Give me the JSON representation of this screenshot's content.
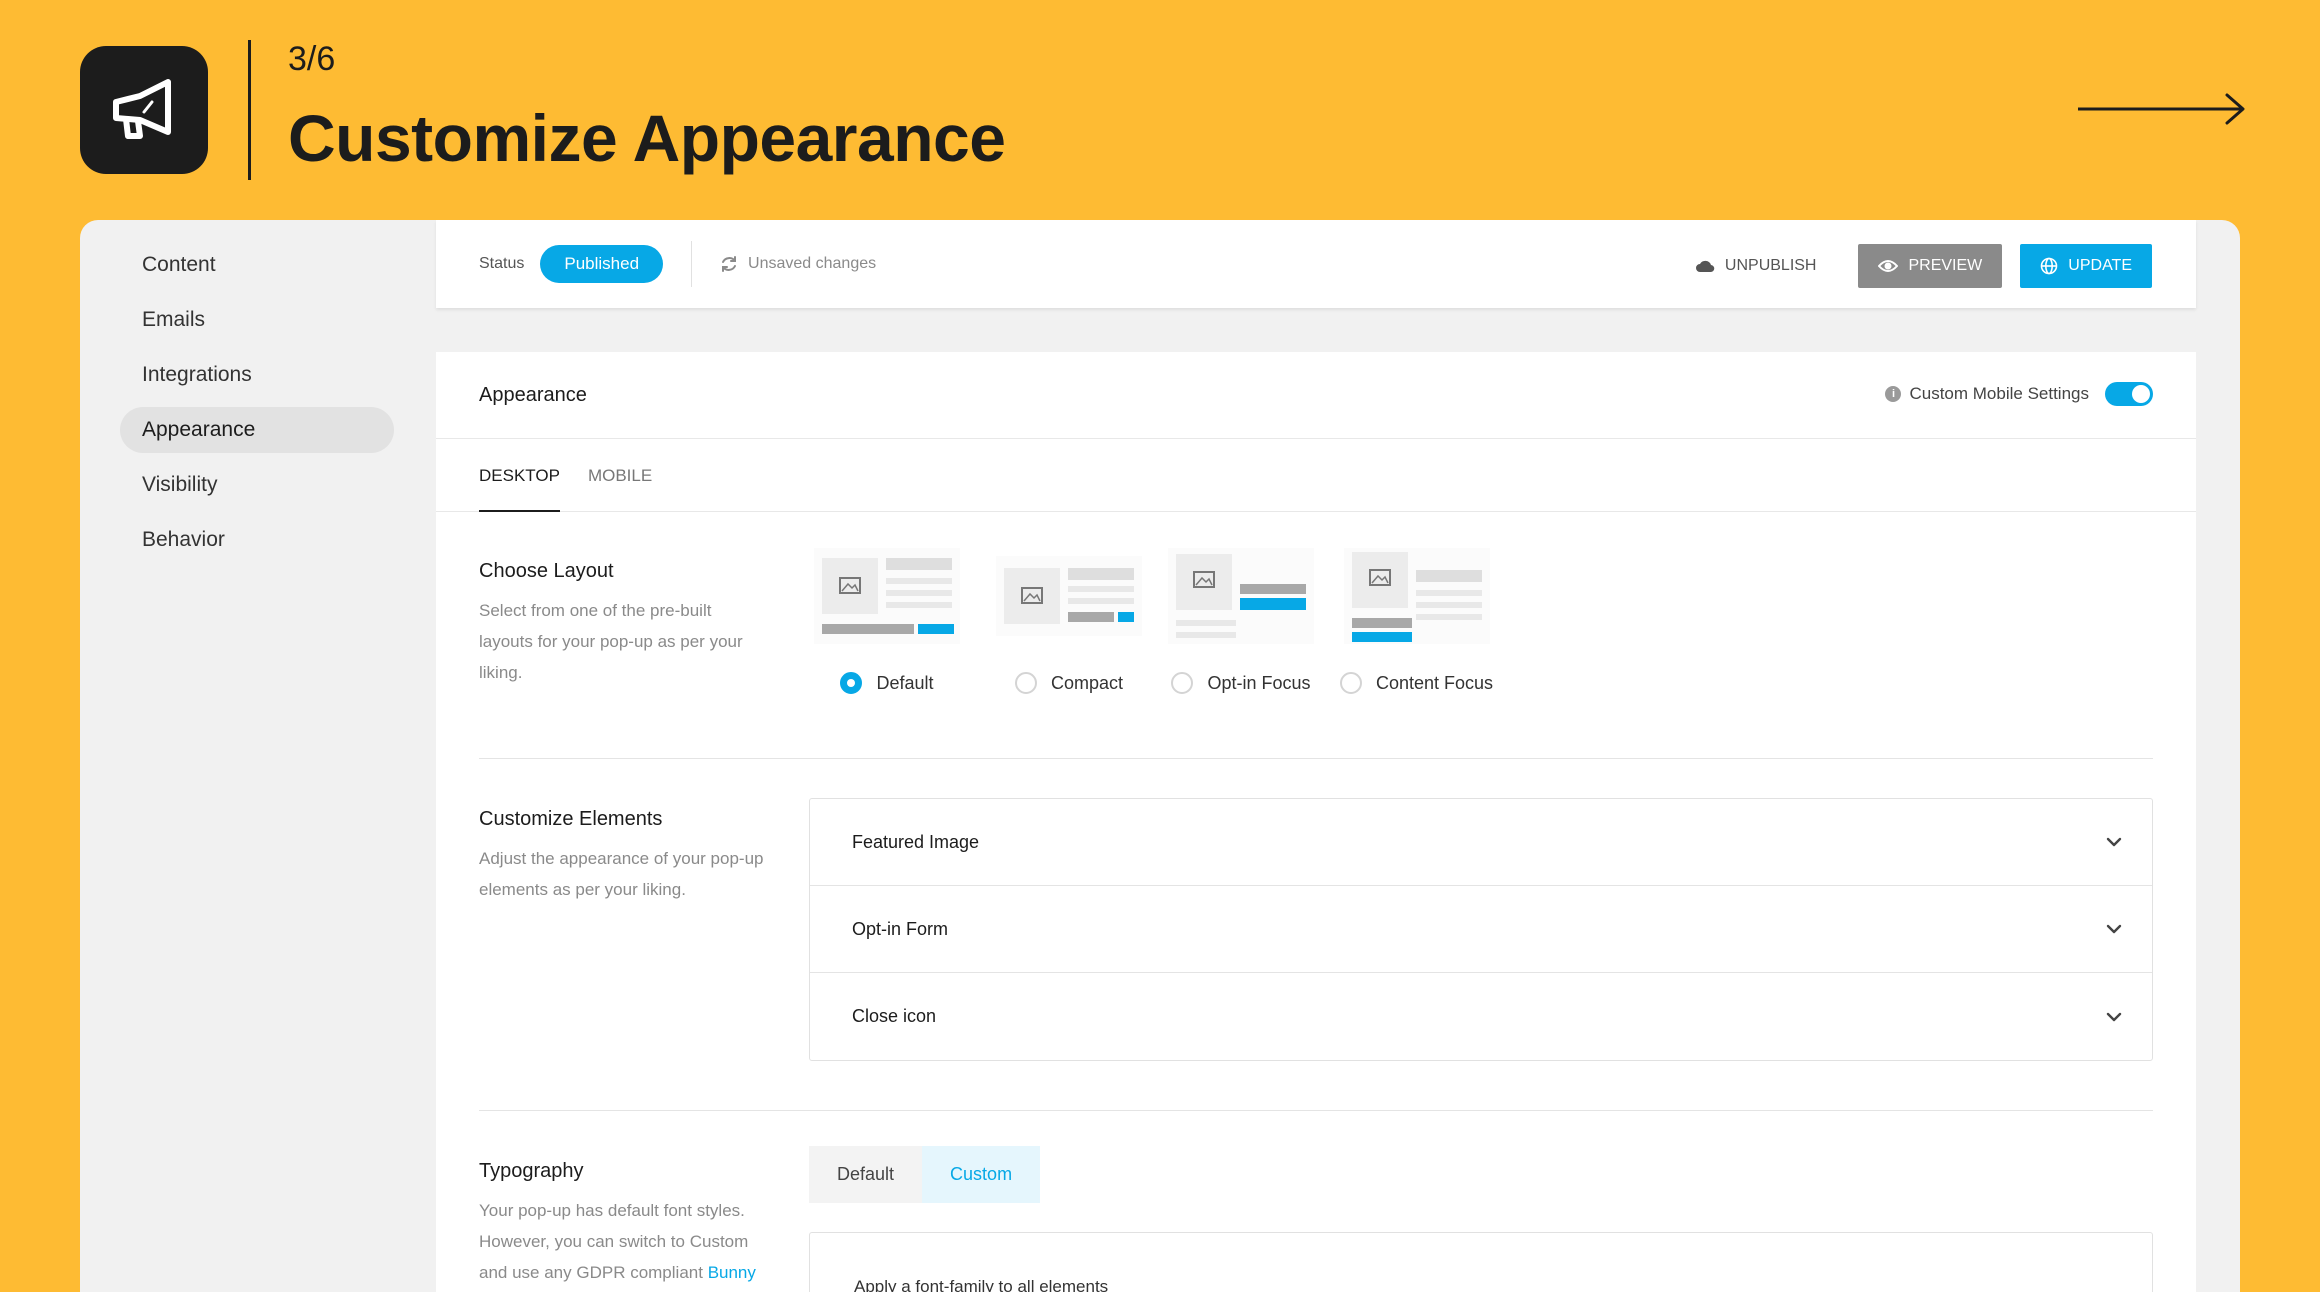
{
  "header": {
    "step": "3/6",
    "title": "Customize Appearance",
    "logo_icon": "megaphone-icon",
    "next_icon": "arrow-right-icon"
  },
  "sidebar": {
    "items": [
      {
        "label": "Content"
      },
      {
        "label": "Emails"
      },
      {
        "label": "Integrations"
      },
      {
        "label": "Appearance",
        "active": true
      },
      {
        "label": "Visibility"
      },
      {
        "label": "Behavior"
      }
    ]
  },
  "statusbar": {
    "status_label": "Status",
    "status_value": "Published",
    "unsaved": "Unsaved changes",
    "unpublish": "UNPUBLISH",
    "preview": "PREVIEW",
    "update": "UPDATE"
  },
  "appearance": {
    "title": "Appearance",
    "mobile_settings_label": "Custom Mobile Settings",
    "mobile_settings_on": true,
    "tabs": [
      {
        "label": "DESKTOP"
      },
      {
        "label": "MOBILE"
      }
    ]
  },
  "layout_section": {
    "title": "Choose Layout",
    "desc": "Select from one of the pre-built layouts for your pop-up as per your liking.",
    "options": [
      {
        "label": "Default",
        "selected": true
      },
      {
        "label": "Compact",
        "selected": false
      },
      {
        "label": "Opt-in Focus",
        "selected": false
      },
      {
        "label": "Content Focus",
        "selected": false
      }
    ]
  },
  "elements_section": {
    "title": "Customize Elements",
    "desc": "Adjust the appearance of your pop-up elements as per your liking.",
    "items": [
      {
        "label": "Featured Image"
      },
      {
        "label": "Opt-in Form"
      },
      {
        "label": "Close icon"
      }
    ]
  },
  "typography_section": {
    "title": "Typography",
    "desc": "Your pop-up has default font styles. However, you can switch to Custom and use any GDPR compliant",
    "desc_link": "Bunny",
    "switch": [
      {
        "label": "Default"
      },
      {
        "label": "Custom",
        "active": true
      }
    ],
    "box_text": "Apply a font-family to all elements"
  },
  "colors": {
    "accent": "#07A8E6",
    "background": "#FEBB33"
  }
}
